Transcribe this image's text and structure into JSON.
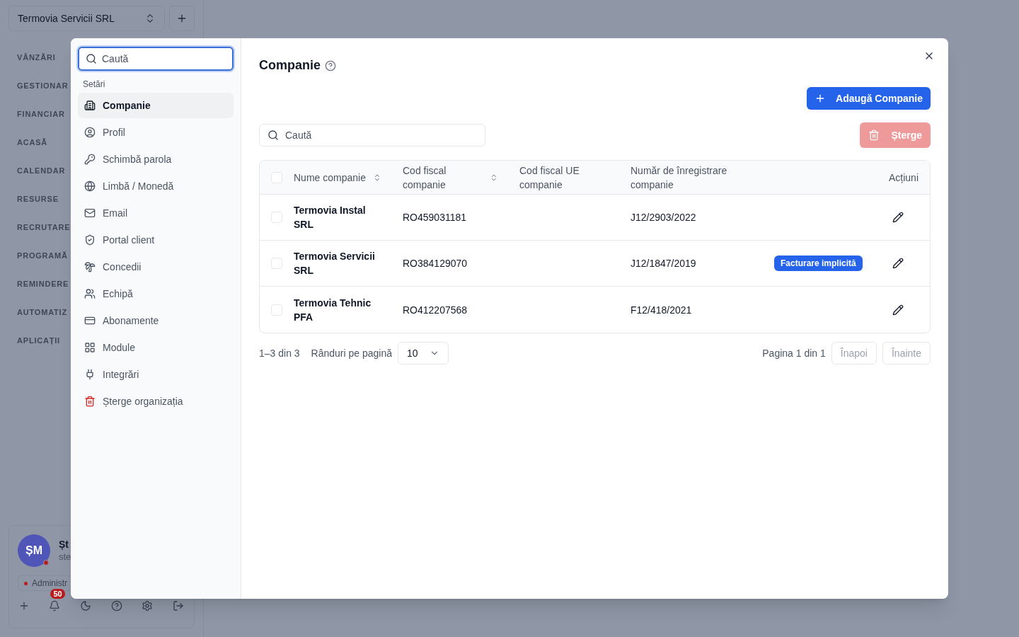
{
  "workspace": {
    "org_switcher": "Termovia Servicii SRL",
    "nav_sections": [
      "VÂNZĂRI",
      "GESTIONAR",
      "FINANCIAR",
      "ACASĂ",
      "CALENDAR",
      "RESURSE",
      "RECRUTARE",
      "PROGRAMĂ",
      "REMINDERE",
      "AUTOMATIZ",
      "APLICAȚII"
    ],
    "user": {
      "initials": "ȘM",
      "name": "Șt",
      "email": "ste",
      "role": "Administr",
      "notifications": "50"
    }
  },
  "dialog": {
    "search": {
      "placeholder": "Caută"
    },
    "menu_heading": "Setări",
    "menu": [
      {
        "label": "Companie",
        "selected": true,
        "kind": "normal"
      },
      {
        "label": "Profil",
        "selected": false,
        "kind": "normal"
      },
      {
        "label": "Schimbă parola",
        "selected": false,
        "kind": "normal"
      },
      {
        "label": "Limbă / Monedă",
        "selected": false,
        "kind": "normal"
      },
      {
        "label": "Email",
        "selected": false,
        "kind": "normal"
      },
      {
        "label": "Portal client",
        "selected": false,
        "kind": "normal"
      },
      {
        "label": "Concedii",
        "selected": false,
        "kind": "normal"
      },
      {
        "label": "Echipă",
        "selected": false,
        "kind": "normal"
      },
      {
        "label": "Abonamente",
        "selected": false,
        "kind": "normal"
      },
      {
        "label": "Module",
        "selected": false,
        "kind": "normal"
      },
      {
        "label": "Integrări",
        "selected": false,
        "kind": "normal"
      },
      {
        "label": "Șterge organizația",
        "selected": false,
        "kind": "danger"
      }
    ],
    "title": "Companie",
    "add_button": "Adaugă Companie",
    "delete_button": {
      "label": "Șterge",
      "disabled": true
    },
    "table_search": {
      "placeholder": "Caută"
    },
    "header_checked": false,
    "columns": [
      {
        "label": "Nume companie",
        "kind": "sortable"
      },
      {
        "label": "Cod fiscal companie",
        "kind": "sortable"
      },
      {
        "label": "Cod fiscal UE companie",
        "kind": "plain"
      },
      {
        "label": "Număr de înregistrare companie",
        "kind": "plain"
      },
      {
        "label": "Acțiuni",
        "kind": "plain"
      }
    ],
    "rows": [
      {
        "checked": false,
        "name": "Termovia Instal SRL",
        "fiscal_code": "RO459031181",
        "reg_no": "J12/2903/2022"
      },
      {
        "checked": false,
        "name": "Termovia Servicii SRL",
        "fiscal_code": "RO384129070",
        "reg_no": "J12/1847/2019",
        "badge": "Facturare implicită"
      },
      {
        "checked": false,
        "name": "Termovia Tehnic PFA",
        "fiscal_code": "RO412207568",
        "reg_no": "F12/418/2021"
      }
    ],
    "pagination": {
      "range": "1–3 din 3",
      "rows_label": "Rânduri pe pagină",
      "rows_value": "10",
      "page": "Pagina 1 din 1",
      "prev": "Înapoi",
      "next": "Înainte"
    }
  }
}
